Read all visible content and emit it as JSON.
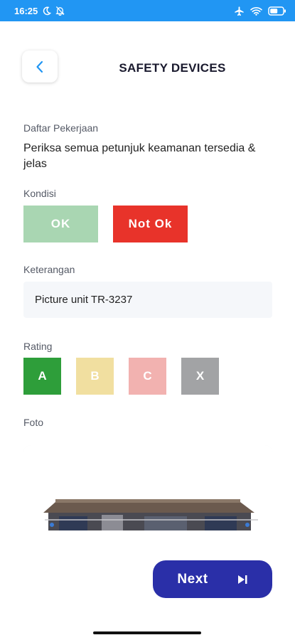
{
  "status_bar": {
    "time": "16:25",
    "icons_left": [
      "moon-icon",
      "bell-off-icon"
    ],
    "icons_right": [
      "airplane-icon",
      "wifi-icon",
      "battery-icon"
    ],
    "color": "#2196f3"
  },
  "header": {
    "title": "SAFETY DEVICES",
    "back_icon": "chevron-left-icon"
  },
  "task": {
    "label": "Daftar Pekerjaan",
    "text": "Periksa semua petunjuk keamanan tersedia & jelas"
  },
  "kondisi": {
    "label": "Kondisi",
    "ok_label": "OK",
    "not_ok_label": "Not Ok",
    "ok_color": "#a9d6b2",
    "not_ok_color": "#e8332a"
  },
  "keterangan": {
    "label": "Keterangan",
    "value": "Picture unit TR-3237"
  },
  "rating": {
    "label": "Rating",
    "options": [
      {
        "label": "A",
        "color": "#2e9e3a"
      },
      {
        "label": "B",
        "color": "#f1dfa0"
      },
      {
        "label": "C",
        "color": "#f2b2b0"
      },
      {
        "label": "X",
        "color": "#a2a3a5"
      }
    ]
  },
  "foto": {
    "label": "Foto"
  },
  "footer": {
    "next_label": "Next",
    "next_icon": "skip-next-icon",
    "next_color": "#2a2fa8"
  }
}
